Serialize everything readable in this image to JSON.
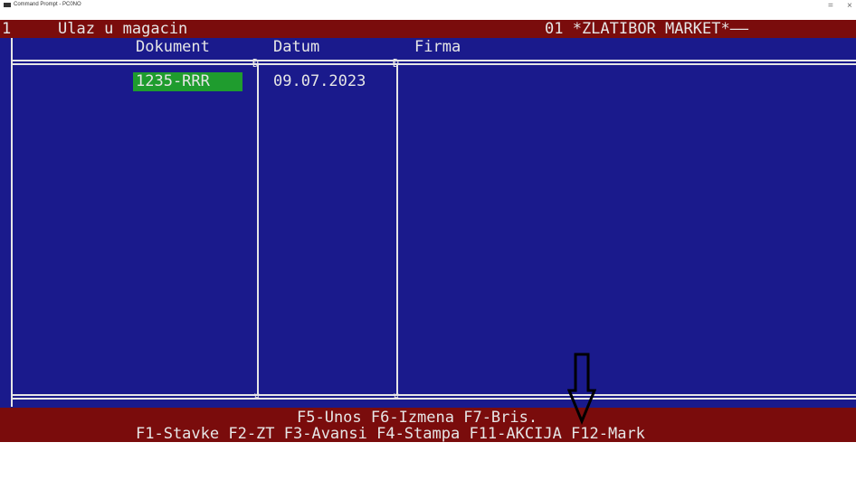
{
  "window": {
    "title": "Command Prompt - PC0NO",
    "minimize": "=",
    "close": "×"
  },
  "topbar": {
    "num": "1",
    "heading": "Ulaz u magacin",
    "company": "01 *ZLATIBOR MARKET*——"
  },
  "columns": {
    "dokument": "Dokument",
    "datum": "Datum",
    "firma": "Firma"
  },
  "rows": [
    {
      "dokument": "1235-RRR",
      "datum": "09.07.2023",
      "firma": ""
    }
  ],
  "fkeys": {
    "line1": "F5-Unos F6-Izmena F7-Bris.",
    "line2": "F1-Stavke F2-ZT F3-Avansi F4-Stampa F11-AKCIJA F12-Mark"
  },
  "colors": {
    "console_bg": "#1a1a8c",
    "bar_bg": "#7a0c0c",
    "highlight": "#1f9c2e",
    "text": "#e6e6e6"
  },
  "icons": [
    "console-icon",
    "down-arrow-icon"
  ]
}
